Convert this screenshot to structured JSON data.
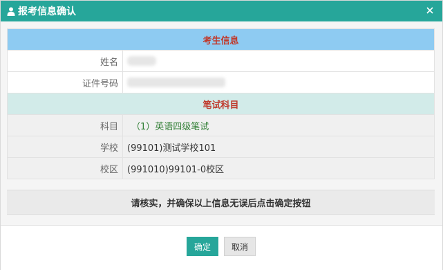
{
  "dialog": {
    "title": "报考信息确认",
    "close_symbol": "×"
  },
  "sections": {
    "candidate_header": "考生信息",
    "exam_header": "笔试科目"
  },
  "candidate": {
    "name_label": "姓名",
    "id_label": "证件号码"
  },
  "exam": {
    "subject_label": "科目",
    "subject_value": "（1）英语四级笔试",
    "school_label": "学校",
    "school_value": "(99101)测试学校101",
    "campus_label": "校区",
    "campus_value": "(991010)99101-0校区"
  },
  "notice": "请核实，并确保以上信息无误后点击确定按钮",
  "buttons": {
    "confirm": "确定",
    "cancel": "取消"
  },
  "colors": {
    "accent": "#26a69a",
    "section_blue": "#8ecbf2",
    "section_green": "#d2ebe9",
    "header_text": "#c0392b",
    "subject_text": "#2e7d32"
  },
  "icons": {
    "title_icon": "user-icon",
    "close_icon": "close-icon"
  }
}
